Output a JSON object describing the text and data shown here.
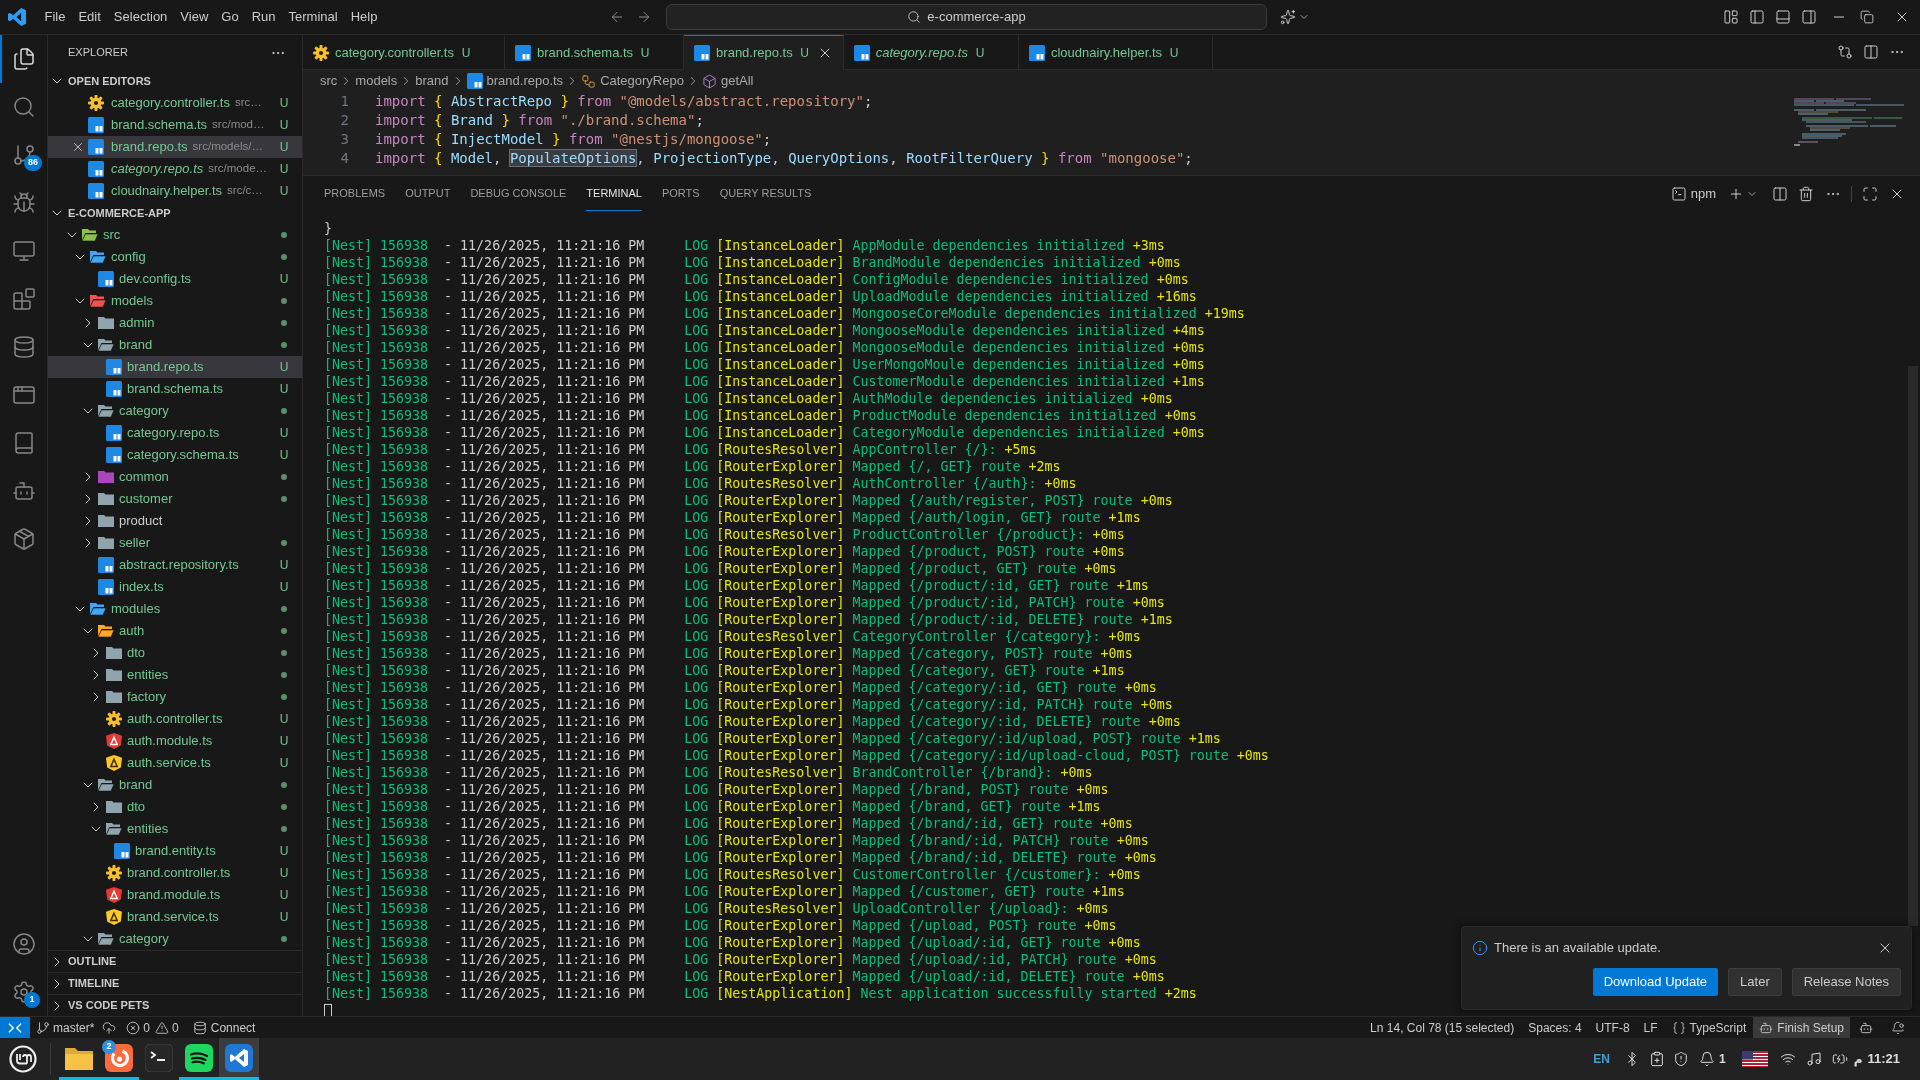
{
  "title_bar": {
    "menus": [
      "File",
      "Edit",
      "Selection",
      "View",
      "Go",
      "Run",
      "Terminal",
      "Help"
    ],
    "command_center": "e-commerce-app"
  },
  "activity_bar": {
    "items": [
      {
        "kind": "files",
        "selected": true
      },
      {
        "kind": "search",
        "selected": false
      },
      {
        "kind": "scm",
        "selected": false,
        "badge": "86"
      },
      {
        "kind": "debug",
        "selected": false
      },
      {
        "kind": "remote",
        "selected": false
      },
      {
        "kind": "extensions",
        "selected": false
      },
      {
        "kind": "database",
        "selected": false
      },
      {
        "kind": "sql",
        "selected": false
      },
      {
        "kind": "book",
        "selected": false
      },
      {
        "kind": "bot",
        "selected": false
      },
      {
        "kind": "package",
        "selected": false
      }
    ],
    "bottom": [
      {
        "kind": "accounts"
      },
      {
        "kind": "settings",
        "badge": "1"
      }
    ]
  },
  "explorer": {
    "title": "EXPLORER",
    "open_editors": {
      "title": "OPEN EDITORS",
      "expanded": true,
      "items": [
        {
          "name": "category.controller.ts",
          "path": "src…",
          "kind": "controller",
          "decoration": "U",
          "selected": false,
          "preview": false
        },
        {
          "name": "brand.schema.ts",
          "path": "src/mod…",
          "kind": "typescript",
          "decoration": "U",
          "selected": false,
          "preview": false
        },
        {
          "name": "brand.repo.ts",
          "path": "src/models/…",
          "kind": "typescript",
          "decoration": "U",
          "selected": true,
          "preview": false
        },
        {
          "name": "category.repo.ts",
          "path": "src/mode…",
          "kind": "typescript",
          "decoration": "U",
          "selected": false,
          "preview": true
        },
        {
          "name": "cloudnairy.helper.ts",
          "path": "src/c…",
          "kind": "typescript",
          "decoration": "U",
          "selected": false,
          "preview": false
        }
      ]
    },
    "workspace": {
      "title": "E-COMMERCE-APP",
      "expanded": true,
      "tree": [
        {
          "name": "src",
          "kind": "folder",
          "color": "#8bc34a",
          "expanded": true,
          "dot": true,
          "selected": false,
          "children": [
            {
              "name": "config",
              "kind": "folder",
              "color": "#42a5f5",
              "expanded": true,
              "dot": true,
              "selected": false,
              "children": [
                {
                  "name": "dev.config.ts",
                  "kind": "typescript",
                  "decoration": "U",
                  "selected": false
                }
              ]
            },
            {
              "name": "models",
              "kind": "folder",
              "color": "#ef5350",
              "expanded": true,
              "dot": true,
              "selected": false,
              "children": [
                {
                  "name": "admin",
                  "kind": "folder",
                  "color": "#90a4ae",
                  "expanded": false,
                  "dot": true,
                  "selected": false
                },
                {
                  "name": "brand",
                  "kind": "folder",
                  "color": "#90a4ae",
                  "expanded": true,
                  "dot": true,
                  "selected": false,
                  "children": [
                    {
                      "name": "brand.repo.ts",
                      "kind": "typescript",
                      "decoration": "U",
                      "selected": true
                    },
                    {
                      "name": "brand.schema.ts",
                      "kind": "typescript",
                      "decoration": "U",
                      "selected": false
                    }
                  ]
                },
                {
                  "name": "category",
                  "kind": "folder",
                  "color": "#90a4ae",
                  "expanded": true,
                  "dot": true,
                  "selected": false,
                  "children": [
                    {
                      "name": "category.repo.ts",
                      "kind": "typescript",
                      "decoration": "U",
                      "selected": false
                    },
                    {
                      "name": "category.schema.ts",
                      "kind": "typescript",
                      "decoration": "U",
                      "selected": false
                    }
                  ]
                },
                {
                  "name": "common",
                  "kind": "folder",
                  "color": "#ab47bc",
                  "expanded": false,
                  "dot": true,
                  "selected": false
                },
                {
                  "name": "customer",
                  "kind": "folder",
                  "color": "#90a4ae",
                  "expanded": false,
                  "dot": true,
                  "selected": false
                },
                {
                  "name": "product",
                  "kind": "folder",
                  "color": "#90a4ae",
                  "expanded": false,
                  "dot": false,
                  "selected": false
                },
                {
                  "name": "seller",
                  "kind": "folder",
                  "color": "#90a4ae",
                  "expanded": false,
                  "dot": true,
                  "selected": false
                },
                {
                  "name": "abstract.repository.ts",
                  "kind": "typescript",
                  "decoration": "U",
                  "selected": false
                },
                {
                  "name": "index.ts",
                  "kind": "typescript",
                  "decoration": "U",
                  "selected": false
                }
              ]
            },
            {
              "name": "modules",
              "kind": "folder",
              "color": "#42a5f5",
              "expanded": true,
              "dot": true,
              "selected": false,
              "children": [
                {
                  "name": "auth",
                  "kind": "folder",
                  "color": "#ffa726",
                  "expanded": true,
                  "dot": true,
                  "selected": false,
                  "children": [
                    {
                      "name": "dto",
                      "kind": "folder",
                      "color": "#90a4ae",
                      "expanded": false,
                      "dot": true,
                      "selected": false
                    },
                    {
                      "name": "entities",
                      "kind": "folder",
                      "color": "#90a4ae",
                      "expanded": false,
                      "dot": true,
                      "selected": false
                    },
                    {
                      "name": "factory",
                      "kind": "folder",
                      "color": "#90a4ae",
                      "expanded": false,
                      "dot": true,
                      "selected": false
                    },
                    {
                      "name": "auth.controller.ts",
                      "kind": "controller",
                      "decoration": "U",
                      "selected": false
                    },
                    {
                      "name": "auth.module.ts",
                      "kind": "module",
                      "decoration": "U",
                      "selected": false
                    },
                    {
                      "name": "auth.service.ts",
                      "kind": "service",
                      "decoration": "U",
                      "selected": false
                    }
                  ]
                },
                {
                  "name": "brand",
                  "kind": "folder",
                  "color": "#90a4ae",
                  "expanded": true,
                  "dot": true,
                  "selected": false,
                  "children": [
                    {
                      "name": "dto",
                      "kind": "folder",
                      "color": "#90a4ae",
                      "expanded": false,
                      "dot": true,
                      "selected": false
                    },
                    {
                      "name": "entities",
                      "kind": "folder",
                      "color": "#90a4ae",
                      "expanded": true,
                      "dot": true,
                      "selected": false,
                      "children": [
                        {
                          "name": "brand.entity.ts",
                          "kind": "typescript",
                          "decoration": "U",
                          "selected": false
                        }
                      ]
                    },
                    {
                      "name": "brand.controller.ts",
                      "kind": "controller",
                      "decoration": "U",
                      "selected": false
                    },
                    {
                      "name": "brand.module.ts",
                      "kind": "module",
                      "decoration": "U",
                      "selected": false
                    },
                    {
                      "name": "brand.service.ts",
                      "kind": "service",
                      "decoration": "U",
                      "selected": false
                    }
                  ]
                },
                {
                  "name": "category",
                  "kind": "folder",
                  "color": "#90a4ae",
                  "expanded": true,
                  "dot": true,
                  "selected": false
                }
              ]
            }
          ]
        }
      ]
    },
    "sections": [
      {
        "title": "OUTLINE",
        "expanded": false
      },
      {
        "title": "TIMELINE",
        "expanded": false
      },
      {
        "title": "VS CODE PETS",
        "expanded": false
      }
    ]
  },
  "tabs": [
    {
      "label": "category.controller.ts",
      "kind": "controller",
      "decoration": "U",
      "selected": false,
      "preview": false
    },
    {
      "label": "brand.schema.ts",
      "kind": "typescript",
      "decoration": "U",
      "selected": false,
      "preview": false
    },
    {
      "label": "brand.repo.ts",
      "kind": "typescript",
      "decoration": "U",
      "selected": true,
      "preview": false
    },
    {
      "label": "category.repo.ts",
      "kind": "typescript",
      "decoration": "U",
      "selected": false,
      "preview": true
    },
    {
      "label": "cloudnairy.helper.ts",
      "kind": "typescript",
      "decoration": "U",
      "selected": false,
      "preview": false
    }
  ],
  "breadcrumbs": [
    {
      "label": "src",
      "kind": "folder"
    },
    {
      "label": "models",
      "kind": "folder"
    },
    {
      "label": "brand",
      "kind": "folder"
    },
    {
      "label": "brand.repo.ts",
      "kind": "typescript"
    },
    {
      "label": "CategoryRepo",
      "kind": "class"
    },
    {
      "label": "getAll",
      "kind": "method"
    }
  ],
  "editor": {
    "lines": [
      {
        "number": "1",
        "tokens": [
          {
            "kind": "keyword",
            "text": "import"
          },
          {
            "kind": "brace",
            "text": "{"
          },
          {
            "kind": "ident",
            "text": "AbstractRepo"
          },
          {
            "kind": "brace",
            "text": "}"
          },
          {
            "kind": "keyword",
            "text": "from"
          },
          {
            "kind": "string",
            "text": "\"@models/abstract.repository\""
          },
          {
            "kind": "punct",
            "text": ";"
          }
        ]
      },
      {
        "number": "2",
        "tokens": [
          {
            "kind": "keyword",
            "text": "import"
          },
          {
            "kind": "brace",
            "text": "{"
          },
          {
            "kind": "ident",
            "text": "Brand"
          },
          {
            "kind": "brace",
            "text": "}"
          },
          {
            "kind": "keyword",
            "text": "from"
          },
          {
            "kind": "string",
            "text": "\"./brand.schema\""
          },
          {
            "kind": "punct",
            "text": ";"
          }
        ]
      },
      {
        "number": "3",
        "tokens": [
          {
            "kind": "keyword",
            "text": "import"
          },
          {
            "kind": "brace",
            "text": "{"
          },
          {
            "kind": "ident",
            "text": "InjectModel"
          },
          {
            "kind": "brace",
            "text": "}"
          },
          {
            "kind": "keyword",
            "text": "from"
          },
          {
            "kind": "string",
            "text": "\"@nestjs/mongoose\""
          },
          {
            "kind": "punct",
            "text": ";"
          }
        ]
      },
      {
        "number": "4",
        "tokens": [
          {
            "kind": "keyword",
            "text": "import"
          },
          {
            "kind": "brace",
            "text": "{"
          },
          {
            "kind": "ident",
            "text": "Model"
          },
          {
            "kind": "punct",
            "text": ","
          },
          {
            "kind": "match",
            "text": "PopulateOptions"
          },
          {
            "kind": "punct",
            "text": ","
          },
          {
            "kind": "ident",
            "text": "ProjectionType"
          },
          {
            "kind": "punct",
            "text": ","
          },
          {
            "kind": "ident",
            "text": "QueryOptions"
          },
          {
            "kind": "punct",
            "text": ","
          },
          {
            "kind": "ident",
            "text": "RootFilterQuery"
          },
          {
            "kind": "brace",
            "text": "}"
          },
          {
            "kind": "keyword",
            "text": "from"
          },
          {
            "kind": "string",
            "text": "\"mongoose\""
          },
          {
            "kind": "punct",
            "text": ";"
          }
        ]
      }
    ]
  },
  "panel": {
    "tabs": [
      {
        "label": "PROBLEMS",
        "selected": false
      },
      {
        "label": "OUTPUT",
        "selected": false
      },
      {
        "label": "DEBUG CONSOLE",
        "selected": false
      },
      {
        "label": "TERMINAL",
        "selected": true
      },
      {
        "label": "PORTS",
        "selected": false
      },
      {
        "label": "QUERY RESULTS",
        "selected": false
      }
    ],
    "terminal": {
      "shell": "npm",
      "cursor": true,
      "lines": [
        {
          "kind": "text",
          "text": "}"
        },
        {
          "kind": "log",
          "source": "[Nest] 156938",
          "time": "- 11/26/2025, 11:21:16 PM",
          "level": "LOG",
          "context": "[InstanceLoader]",
          "message": "AppModule dependencies initialized",
          "elapsed": "+3ms"
        },
        {
          "kind": "log",
          "source": "[Nest] 156938",
          "time": "- 11/26/2025, 11:21:16 PM",
          "level": "LOG",
          "context": "[InstanceLoader]",
          "message": "BrandModule dependencies initialized",
          "elapsed": "+0ms"
        },
        {
          "kind": "log",
          "source": "[Nest] 156938",
          "time": "- 11/26/2025, 11:21:16 PM",
          "level": "LOG",
          "context": "[InstanceLoader]",
          "message": "ConfigModule dependencies initialized",
          "elapsed": "+0ms"
        },
        {
          "kind": "log",
          "source": "[Nest] 156938",
          "time": "- 11/26/2025, 11:21:16 PM",
          "level": "LOG",
          "context": "[InstanceLoader]",
          "message": "UploadModule dependencies initialized",
          "elapsed": "+16ms"
        },
        {
          "kind": "log",
          "source": "[Nest] 156938",
          "time": "- 11/26/2025, 11:21:16 PM",
          "level": "LOG",
          "context": "[InstanceLoader]",
          "message": "MongooseCoreModule dependencies initialized",
          "elapsed": "+19ms"
        },
        {
          "kind": "log",
          "source": "[Nest] 156938",
          "time": "- 11/26/2025, 11:21:16 PM",
          "level": "LOG",
          "context": "[InstanceLoader]",
          "message": "MongooseModule dependencies initialized",
          "elapsed": "+4ms"
        },
        {
          "kind": "log",
          "source": "[Nest] 156938",
          "time": "- 11/26/2025, 11:21:16 PM",
          "level": "LOG",
          "context": "[InstanceLoader]",
          "message": "MongooseModule dependencies initialized",
          "elapsed": "+0ms"
        },
        {
          "kind": "log",
          "source": "[Nest] 156938",
          "time": "- 11/26/2025, 11:21:16 PM",
          "level": "LOG",
          "context": "[InstanceLoader]",
          "message": "UserMongoMoule dependencies initialized",
          "elapsed": "+0ms"
        },
        {
          "kind": "log",
          "source": "[Nest] 156938",
          "time": "- 11/26/2025, 11:21:16 PM",
          "level": "LOG",
          "context": "[InstanceLoader]",
          "message": "CustomerModule dependencies initialized",
          "elapsed": "+1ms"
        },
        {
          "kind": "log",
          "source": "[Nest] 156938",
          "time": "- 11/26/2025, 11:21:16 PM",
          "level": "LOG",
          "context": "[InstanceLoader]",
          "message": "AuthModule dependencies initialized",
          "elapsed": "+0ms"
        },
        {
          "kind": "log",
          "source": "[Nest] 156938",
          "time": "- 11/26/2025, 11:21:16 PM",
          "level": "LOG",
          "context": "[InstanceLoader]",
          "message": "ProductModule dependencies initialized",
          "elapsed": "+0ms"
        },
        {
          "kind": "log",
          "source": "[Nest] 156938",
          "time": "- 11/26/2025, 11:21:16 PM",
          "level": "LOG",
          "context": "[InstanceLoader]",
          "message": "CategoryModule dependencies initialized",
          "elapsed": "+0ms"
        },
        {
          "kind": "log",
          "source": "[Nest] 156938",
          "time": "- 11/26/2025, 11:21:16 PM",
          "level": "LOG",
          "context": "[RoutesResolver]",
          "message": "AppController {/}:",
          "elapsed": "+5ms"
        },
        {
          "kind": "log",
          "source": "[Nest] 156938",
          "time": "- 11/26/2025, 11:21:16 PM",
          "level": "LOG",
          "context": "[RouterExplorer]",
          "message": "Mapped {/, GET} route",
          "elapsed": "+2ms"
        },
        {
          "kind": "log",
          "source": "[Nest] 156938",
          "time": "- 11/26/2025, 11:21:16 PM",
          "level": "LOG",
          "context": "[RoutesResolver]",
          "message": "AuthController {/auth}:",
          "elapsed": "+0ms"
        },
        {
          "kind": "log",
          "source": "[Nest] 156938",
          "time": "- 11/26/2025, 11:21:16 PM",
          "level": "LOG",
          "context": "[RouterExplorer]",
          "message": "Mapped {/auth/register, POST} route",
          "elapsed": "+0ms"
        },
        {
          "kind": "log",
          "source": "[Nest] 156938",
          "time": "- 11/26/2025, 11:21:16 PM",
          "level": "LOG",
          "context": "[RouterExplorer]",
          "message": "Mapped {/auth/login, GET} route",
          "elapsed": "+1ms"
        },
        {
          "kind": "log",
          "source": "[Nest] 156938",
          "time": "- 11/26/2025, 11:21:16 PM",
          "level": "LOG",
          "context": "[RoutesResolver]",
          "message": "ProductController {/product}:",
          "elapsed": "+0ms"
        },
        {
          "kind": "log",
          "source": "[Nest] 156938",
          "time": "- 11/26/2025, 11:21:16 PM",
          "level": "LOG",
          "context": "[RouterExplorer]",
          "message": "Mapped {/product, POST} route",
          "elapsed": "+0ms"
        },
        {
          "kind": "log",
          "source": "[Nest] 156938",
          "time": "- 11/26/2025, 11:21:16 PM",
          "level": "LOG",
          "context": "[RouterExplorer]",
          "message": "Mapped {/product, GET} route",
          "elapsed": "+0ms"
        },
        {
          "kind": "log",
          "source": "[Nest] 156938",
          "time": "- 11/26/2025, 11:21:16 PM",
          "level": "LOG",
          "context": "[RouterExplorer]",
          "message": "Mapped {/product/:id, GET} route",
          "elapsed": "+1ms"
        },
        {
          "kind": "log",
          "source": "[Nest] 156938",
          "time": "- 11/26/2025, 11:21:16 PM",
          "level": "LOG",
          "context": "[RouterExplorer]",
          "message": "Mapped {/product/:id, PATCH} route",
          "elapsed": "+0ms"
        },
        {
          "kind": "log",
          "source": "[Nest] 156938",
          "time": "- 11/26/2025, 11:21:16 PM",
          "level": "LOG",
          "context": "[RouterExplorer]",
          "message": "Mapped {/product/:id, DELETE} route",
          "elapsed": "+1ms"
        },
        {
          "kind": "log",
          "source": "[Nest] 156938",
          "time": "- 11/26/2025, 11:21:16 PM",
          "level": "LOG",
          "context": "[RoutesResolver]",
          "message": "CategoryController {/category}:",
          "elapsed": "+0ms"
        },
        {
          "kind": "log",
          "source": "[Nest] 156938",
          "time": "- 11/26/2025, 11:21:16 PM",
          "level": "LOG",
          "context": "[RouterExplorer]",
          "message": "Mapped {/category, POST} route",
          "elapsed": "+0ms"
        },
        {
          "kind": "log",
          "source": "[Nest] 156938",
          "time": "- 11/26/2025, 11:21:16 PM",
          "level": "LOG",
          "context": "[RouterExplorer]",
          "message": "Mapped {/category, GET} route",
          "elapsed": "+1ms"
        },
        {
          "kind": "log",
          "source": "[Nest] 156938",
          "time": "- 11/26/2025, 11:21:16 PM",
          "level": "LOG",
          "context": "[RouterExplorer]",
          "message": "Mapped {/category/:id, GET} route",
          "elapsed": "+0ms"
        },
        {
          "kind": "log",
          "source": "[Nest] 156938",
          "time": "- 11/26/2025, 11:21:16 PM",
          "level": "LOG",
          "context": "[RouterExplorer]",
          "message": "Mapped {/category/:id, PATCH} route",
          "elapsed": "+0ms"
        },
        {
          "kind": "log",
          "source": "[Nest] 156938",
          "time": "- 11/26/2025, 11:21:16 PM",
          "level": "LOG",
          "context": "[RouterExplorer]",
          "message": "Mapped {/category/:id, DELETE} route",
          "elapsed": "+0ms"
        },
        {
          "kind": "log",
          "source": "[Nest] 156938",
          "time": "- 11/26/2025, 11:21:16 PM",
          "level": "LOG",
          "context": "[RouterExplorer]",
          "message": "Mapped {/category/:id/upload, POST} route",
          "elapsed": "+1ms"
        },
        {
          "kind": "log",
          "source": "[Nest] 156938",
          "time": "- 11/26/2025, 11:21:16 PM",
          "level": "LOG",
          "context": "[RouterExplorer]",
          "message": "Mapped {/category/:id/upload-cloud, POST} route",
          "elapsed": "+0ms"
        },
        {
          "kind": "log",
          "source": "[Nest] 156938",
          "time": "- 11/26/2025, 11:21:16 PM",
          "level": "LOG",
          "context": "[RoutesResolver]",
          "message": "BrandController {/brand}:",
          "elapsed": "+0ms"
        },
        {
          "kind": "log",
          "source": "[Nest] 156938",
          "time": "- 11/26/2025, 11:21:16 PM",
          "level": "LOG",
          "context": "[RouterExplorer]",
          "message": "Mapped {/brand, POST} route",
          "elapsed": "+0ms"
        },
        {
          "kind": "log",
          "source": "[Nest] 156938",
          "time": "- 11/26/2025, 11:21:16 PM",
          "level": "LOG",
          "context": "[RouterExplorer]",
          "message": "Mapped {/brand, GET} route",
          "elapsed": "+1ms"
        },
        {
          "kind": "log",
          "source": "[Nest] 156938",
          "time": "- 11/26/2025, 11:21:16 PM",
          "level": "LOG",
          "context": "[RouterExplorer]",
          "message": "Mapped {/brand/:id, GET} route",
          "elapsed": "+0ms"
        },
        {
          "kind": "log",
          "source": "[Nest] 156938",
          "time": "- 11/26/2025, 11:21:16 PM",
          "level": "LOG",
          "context": "[RouterExplorer]",
          "message": "Mapped {/brand/:id, PATCH} route",
          "elapsed": "+0ms"
        },
        {
          "kind": "log",
          "source": "[Nest] 156938",
          "time": "- 11/26/2025, 11:21:16 PM",
          "level": "LOG",
          "context": "[RouterExplorer]",
          "message": "Mapped {/brand/:id, DELETE} route",
          "elapsed": "+0ms"
        },
        {
          "kind": "log",
          "source": "[Nest] 156938",
          "time": "- 11/26/2025, 11:21:16 PM",
          "level": "LOG",
          "context": "[RoutesResolver]",
          "message": "CustomerController {/customer}:",
          "elapsed": "+0ms"
        },
        {
          "kind": "log",
          "source": "[Nest] 156938",
          "time": "- 11/26/2025, 11:21:16 PM",
          "level": "LOG",
          "context": "[RouterExplorer]",
          "message": "Mapped {/customer, GET} route",
          "elapsed": "+1ms"
        },
        {
          "kind": "log",
          "source": "[Nest] 156938",
          "time": "- 11/26/2025, 11:21:16 PM",
          "level": "LOG",
          "context": "[RoutesResolver]",
          "message": "UploadController {/upload}:",
          "elapsed": "+0ms"
        },
        {
          "kind": "log",
          "source": "[Nest] 156938",
          "time": "- 11/26/2025, 11:21:16 PM",
          "level": "LOG",
          "context": "[RouterExplorer]",
          "message": "Mapped {/upload, POST} route",
          "elapsed": "+0ms"
        },
        {
          "kind": "log",
          "source": "[Nest] 156938",
          "time": "- 11/26/2025, 11:21:16 PM",
          "level": "LOG",
          "context": "[RouterExplorer]",
          "message": "Mapped {/upload/:id, GET} route",
          "elapsed": "+0ms"
        },
        {
          "kind": "log",
          "source": "[Nest] 156938",
          "time": "- 11/26/2025, 11:21:16 PM",
          "level": "LOG",
          "context": "[RouterExplorer]",
          "message": "Mapped {/upload/:id, PATCH} route",
          "elapsed": "+0ms"
        },
        {
          "kind": "log",
          "source": "[Nest] 156938",
          "time": "- 11/26/2025, 11:21:16 PM",
          "level": "LOG",
          "context": "[RouterExplorer]",
          "message": "Mapped {/upload/:id, DELETE} route",
          "elapsed": "+0ms"
        },
        {
          "kind": "log",
          "source": "[Nest] 156938",
          "time": "- 11/26/2025, 11:21:16 PM",
          "level": "LOG",
          "context": "[NestApplication]",
          "message": "Nest application successfully started",
          "elapsed": "+2ms"
        }
      ]
    }
  },
  "notification": {
    "message": "There is an available update.",
    "buttons": [
      {
        "label": "Download Update",
        "primary": true
      },
      {
        "label": "Later",
        "primary": false
      },
      {
        "label": "Release Notes",
        "primary": false
      }
    ]
  },
  "status_bar": {
    "left": [
      {
        "kind": "remote"
      },
      {
        "kind": "branch",
        "label": "master*"
      },
      {
        "kind": "sync"
      },
      {
        "kind": "problems",
        "errors": "0",
        "warnings": "0"
      },
      {
        "kind": "connection",
        "label": "Connect"
      }
    ],
    "right": [
      {
        "kind": "text",
        "label": "Ln 14, Col 78 (15 selected)"
      },
      {
        "kind": "text",
        "label": "Spaces: 4"
      },
      {
        "kind": "text",
        "label": "UTF-8"
      },
      {
        "kind": "text",
        "label": "LF"
      },
      {
        "kind": "language",
        "label": "TypeScript"
      },
      {
        "kind": "setup",
        "label": "Finish Setup"
      },
      {
        "kind": "assistant"
      },
      {
        "kind": "notifications"
      }
    ]
  },
  "taskbar": {
    "apps": [
      {
        "kind": "files",
        "running": true,
        "focused": false
      },
      {
        "kind": "browser",
        "running": true,
        "focused": false,
        "badge": "2"
      },
      {
        "kind": "terminal",
        "running": false,
        "focused": false
      },
      {
        "kind": "music",
        "running": true,
        "focused": false
      },
      {
        "kind": "editor",
        "running": true,
        "focused": true
      }
    ],
    "tray": {
      "keyboard_layout": "EN",
      "notification_count": "1",
      "clock_period": "م",
      "clock": "11:21"
    }
  }
}
